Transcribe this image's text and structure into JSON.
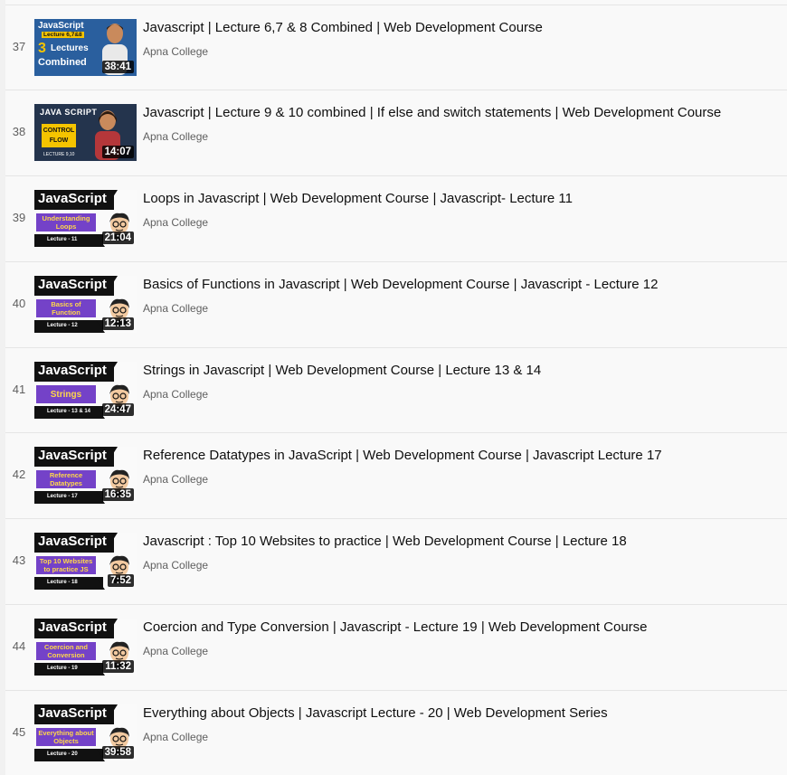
{
  "playlist": {
    "items": [
      {
        "index": "37",
        "title": "Javascript | Lecture 6,7 & 8 Combined | Web Development Course",
        "channel": "Apna College",
        "duration": "38:41",
        "thumb": {
          "style": "lectures",
          "line1": "JavaScript",
          "line2": "Lecture 6,7&8",
          "line3": "3",
          "line4": "Lectures",
          "line5": "Combined"
        }
      },
      {
        "index": "38",
        "title": "Javascript | Lecture 9 & 10 combined | If else and switch statements | Web Development Course",
        "channel": "Apna College",
        "duration": "14:07",
        "thumb": {
          "style": "control",
          "line1": "JAVA SCRIPT",
          "line2": "CONTROL",
          "line3": "FLOW",
          "line4": "LECTURE 9,10"
        }
      },
      {
        "index": "39",
        "title": "Loops in Javascript | Web Development Course | Javascript- Lecture 11",
        "channel": "Apna College",
        "duration": "21:04",
        "thumb": {
          "brand": "JavaScript",
          "topic": "Understanding Loops",
          "lecture": "Lecture - 11"
        }
      },
      {
        "index": "40",
        "title": "Basics of Functions in Javascript | Web Development Course | Javascript - Lecture 12",
        "channel": "Apna College",
        "duration": "12:13",
        "thumb": {
          "brand": "JavaScript",
          "topic": "Basics of Function",
          "lecture": "Lecture - 12"
        }
      },
      {
        "index": "41",
        "title": "Strings in Javascript | Web Development Course | Lecture 13 & 14",
        "channel": "Apna College",
        "duration": "24:47",
        "thumb": {
          "brand": "JavaScript",
          "topic": "Strings",
          "lecture": "Lecture - 13 & 14"
        }
      },
      {
        "index": "42",
        "title": "Reference Datatypes in JavaScript | Web Development Course | Javascript Lecture 17",
        "channel": "Apna College",
        "duration": "16:35",
        "thumb": {
          "brand": "JavaScript",
          "topic": "Reference Datatypes",
          "lecture": "Lecture - 17"
        }
      },
      {
        "index": "43",
        "title": "Javascript : Top 10 Websites to practice | Web Development Course | Lecture 18",
        "channel": "Apna College",
        "duration": "7:52",
        "thumb": {
          "brand": "JavaScript",
          "topic": "Top 10 Websites to practice JS",
          "lecture": "Lecture - 18"
        }
      },
      {
        "index": "44",
        "title": "Coercion and Type Conversion | Javascript - Lecture 19 | Web Development Course",
        "channel": "Apna College",
        "duration": "11:32",
        "thumb": {
          "brand": "JavaScript",
          "topic": "Coercion and Conversion",
          "lecture": "Lecture - 19"
        }
      },
      {
        "index": "45",
        "title": "Everything about Objects | Javascript Lecture - 20 | Web Development Series",
        "channel": "Apna College",
        "duration": "39:58",
        "thumb": {
          "brand": "JavaScript",
          "topic": "Everything about Objects",
          "lecture": "Lecture - 20"
        }
      }
    ]
  },
  "colors": {
    "topic_bg": "#7442c8",
    "topic_text": "#ffd84a",
    "title_text": "#0f0f0f",
    "meta_text": "#606060"
  }
}
